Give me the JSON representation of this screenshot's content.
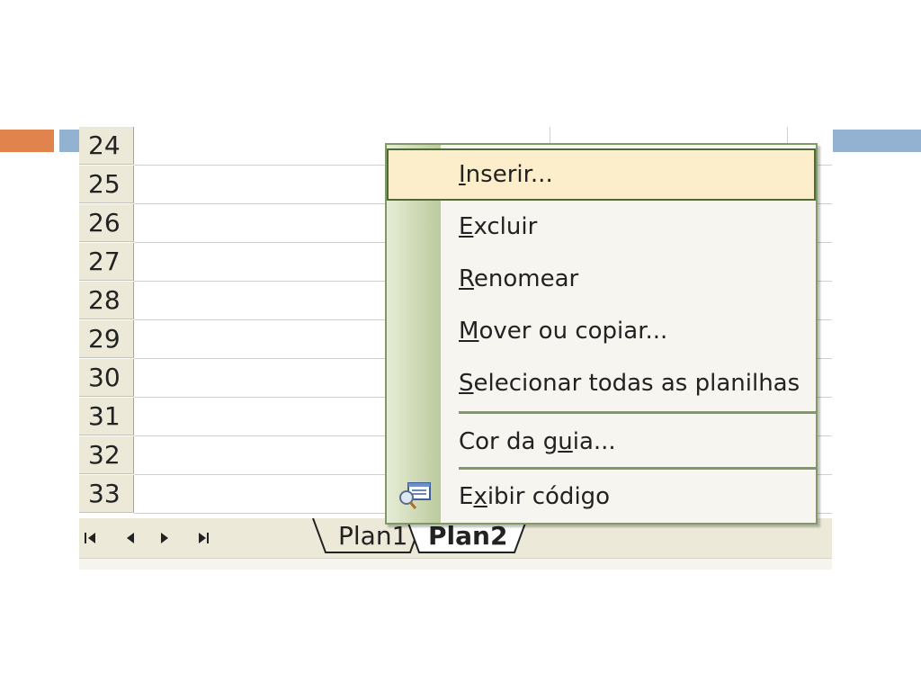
{
  "slide": {
    "accent_orange": "#e0834c",
    "accent_blue": "#93b1d0"
  },
  "sheet": {
    "rows": [
      "24",
      "25",
      "26",
      "27",
      "28",
      "29",
      "30",
      "31",
      "32",
      "33"
    ]
  },
  "tabs": {
    "nav": [
      "first-icon",
      "prev-icon",
      "next-icon",
      "last-icon"
    ],
    "sheets": [
      {
        "name": "Plan1",
        "active": false
      },
      {
        "name": "Plan2",
        "active": true
      }
    ]
  },
  "context_menu": {
    "items": [
      {
        "pre": "",
        "key": "I",
        "post": "nserir...",
        "state": "highlighted"
      },
      {
        "pre": "",
        "key": "E",
        "post": "xcluir"
      },
      {
        "pre": "",
        "key": "R",
        "post": "enomear"
      },
      {
        "pre": "",
        "key": "M",
        "post": "over ou copiar..."
      },
      {
        "pre": "",
        "key": "S",
        "post": "elecionar todas as planilhas"
      },
      {
        "pre": "Cor da g",
        "key": "u",
        "post": "ia..."
      },
      {
        "pre": "E",
        "key": "x",
        "post": "ibir código",
        "icon": "view-code-icon"
      }
    ]
  }
}
